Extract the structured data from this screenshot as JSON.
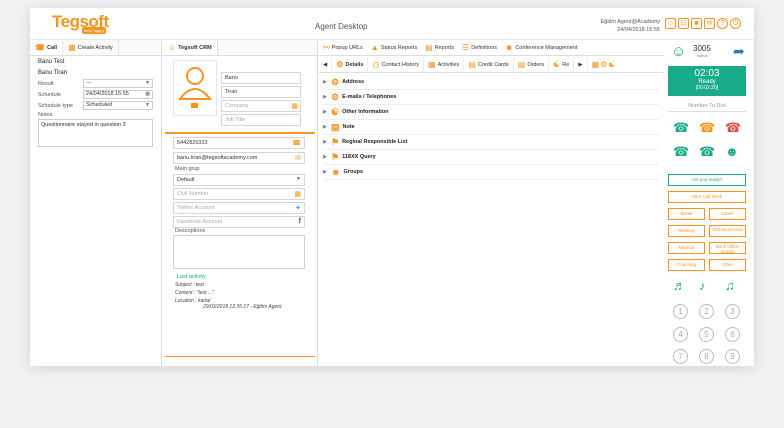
{
  "header": {
    "logo": "Tegsoft",
    "logo_tag": "hello happy",
    "title": "Agent Desktop",
    "user_name": "Eğitim Agent@Academy",
    "date": "24/04/2018 15:55"
  },
  "left": {
    "tabs": [
      {
        "label": "Call",
        "icon": "phone-icon"
      },
      {
        "label": "Create Activity",
        "icon": "calendar-icon"
      }
    ],
    "name1": "Banu Test",
    "name2": "Banu Tiran",
    "result_label": "Result",
    "result_value": "---",
    "schedule_label": "Schedule",
    "schedule_value": "24/04/2018 15:55",
    "schedule_type_label": "Schedule type",
    "schedule_type_value": "Scheduled",
    "notes_label": "Notes",
    "notes_value": "Questionnaire stayed in question 3"
  },
  "mid": {
    "tab_label": "Tegsoft CRM",
    "first_name": "Banu",
    "last_name": "Tiran",
    "company_ph": "Company",
    "job_title_ph": "Job Title",
    "phone": "5442820323",
    "email": "banu.tiran@tegsoftacademy.com",
    "main_group_label": "Main grup",
    "main_group_value": "Default",
    "civil_number_ph": "Civil Number",
    "twitter_ph": "Twitter Account",
    "facebook_ph": "Facebook Account",
    "descriptions_label": "Descriptions",
    "last_activity_label": "Last activity",
    "last_subject": "Subject : test",
    "last_content": "Content : \"test ...\"",
    "last_location": "Location : kartal",
    "last_date": "29/03/2018 12:35:17 - Eğitim Agent"
  },
  "main": {
    "top_tabs": [
      {
        "label": "Popup URLs",
        "icon": "link-icon"
      },
      {
        "label": "Status Reports",
        "icon": "chart-icon"
      },
      {
        "label": "Reports",
        "icon": "report-icon"
      },
      {
        "label": "Definitions",
        "icon": "list-icon"
      },
      {
        "label": "Conference Management",
        "icon": "group-icon"
      }
    ],
    "detail_tabs": [
      {
        "label": "Details",
        "icon": "gear-icon"
      },
      {
        "label": "Contact History",
        "icon": "clock-icon"
      },
      {
        "label": "Activities",
        "icon": "calendar-icon"
      },
      {
        "label": "Credit Cards",
        "icon": "card-icon"
      },
      {
        "label": "Orders",
        "icon": "order-icon"
      },
      {
        "label": "Re",
        "icon": "network-icon"
      }
    ],
    "sections": [
      {
        "label": "Address",
        "icon": "gears-icon"
      },
      {
        "label": "E-mails / Telephones",
        "icon": "gears-icon"
      },
      {
        "label": "Other Information",
        "icon": "network-icon"
      },
      {
        "label": "Note",
        "icon": "note-icon"
      },
      {
        "label": "Reginal Responsible List",
        "icon": "pin-icon"
      },
      {
        "label": "118XX Query",
        "icon": "pin-icon"
      },
      {
        "label": "Groups",
        "icon": "group-icon"
      }
    ]
  },
  "phone": {
    "extension": "3005",
    "ext_sub": "status",
    "time": "02:03",
    "status": "Ready",
    "duration": "[00:02:20]",
    "dial_placeholder": "Number To Dial",
    "ready_button": "Are you ready?",
    "after_call": "After Call Work",
    "break": "Break",
    "lunch": "Lunch",
    "meeting": "Meeting",
    "tech_issue": "Technical Issue",
    "medical": "Medical",
    "back_office": "Back Office Activity",
    "coaching": "Coaching",
    "other": "Other",
    "keys": [
      "1",
      "2",
      "3",
      "4",
      "5",
      "6",
      "7",
      "8",
      "9"
    ]
  },
  "colors": {
    "accent": "#f7931e",
    "ready": "#1aab8a"
  }
}
